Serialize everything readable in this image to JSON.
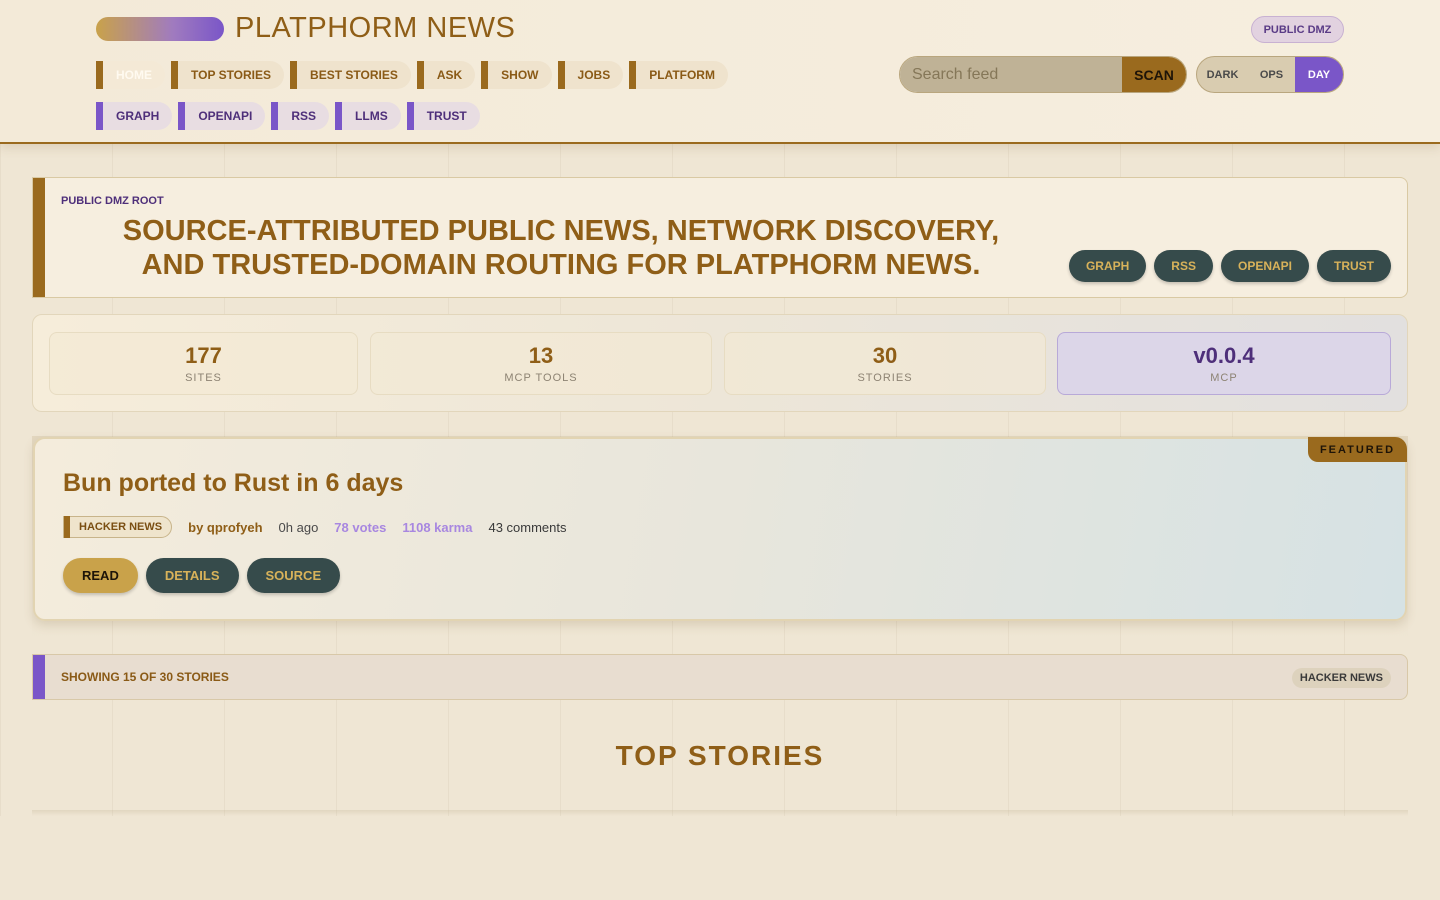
{
  "header": {
    "brand": "PLATPHORM NEWS",
    "badge": "PUBLIC DMZ",
    "nav_primary": [
      "HOME",
      "TOP STORIES",
      "BEST STORIES",
      "ASK",
      "SHOW",
      "JOBS",
      "PLATFORM"
    ],
    "nav_secondary": [
      "GRAPH",
      "OPENAPI",
      "RSS",
      "LLMS",
      "TRUST"
    ],
    "search": {
      "placeholder": "Search feed",
      "value": "",
      "button": "SCAN"
    },
    "modes": [
      "DARK",
      "OPS",
      "DAY"
    ],
    "active_mode": "DAY",
    "active_nav": "HOME"
  },
  "hero": {
    "kicker": "PUBLIC DMZ ROOT",
    "title": "SOURCE-ATTRIBUTED PUBLIC NEWS, NETWORK DISCOVERY, AND TRUSTED-DOMAIN ROUTING FOR PLATPHORM NEWS.",
    "links": [
      "GRAPH",
      "RSS",
      "OPENAPI",
      "TRUST"
    ]
  },
  "stats": [
    {
      "value": "177",
      "label": "SITES"
    },
    {
      "value": "13",
      "label": "MCP TOOLS"
    },
    {
      "value": "30",
      "label": "STORIES"
    },
    {
      "value": "v0.0.4",
      "label": "MCP"
    }
  ],
  "featured": {
    "tag": "FEATURED",
    "title": "Bun ported to Rust in 6 days",
    "source": "HACKER NEWS",
    "by": "by qprofyeh",
    "ago": "0h ago",
    "votes": "78 votes",
    "karma": "1108 karma",
    "comments": "43 comments",
    "actions": {
      "read": "READ",
      "details": "DETAILS",
      "source": "SOURCE"
    }
  },
  "filter": {
    "summary": "SHOWING 15 OF 30 STORIES",
    "source_chip": "HACKER NEWS"
  },
  "section": {
    "title": "TOP STORIES"
  },
  "colors": {
    "accent_gold": "#9a6a1e",
    "accent_violet": "#7a56c8",
    "title_brown": "#8f5e17",
    "dark_pill": "#364b4b"
  }
}
